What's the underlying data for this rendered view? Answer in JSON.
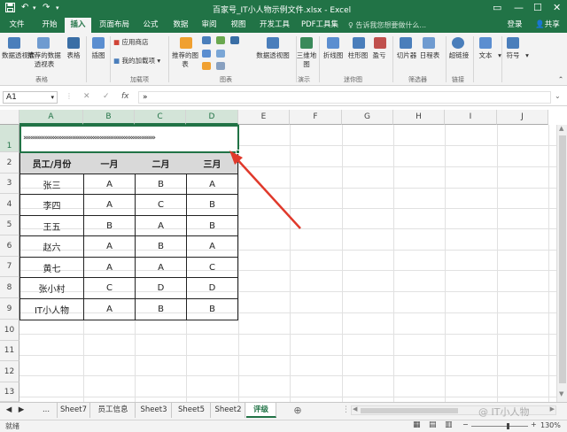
{
  "titlebar": {
    "title": "百家号_IT小人物示例文件.xlsx - Excel",
    "save_icon": "save-icon",
    "undo_icon": "undo-icon",
    "redo_icon": "redo-icon"
  },
  "menu": {
    "tabs": [
      "文件",
      "开始",
      "插入",
      "页面布局",
      "公式",
      "数据",
      "审阅",
      "视图",
      "开发工具",
      "PDF工具集"
    ],
    "active": "插入",
    "tellme": "告诉我您想要做什么...",
    "login": "登录",
    "share": "共享"
  },
  "ribbon": {
    "groups": [
      {
        "label": "表格",
        "buttons": [
          "数据透视表",
          "推荐的数据透视表",
          "表格"
        ]
      },
      {
        "label": "",
        "buttons": [
          "插图"
        ]
      },
      {
        "label": "加载项",
        "buttons": [
          "应用商店",
          "我的加载项"
        ]
      },
      {
        "label": "图表",
        "buttons": [
          "推荐的图表",
          "数据透视图"
        ]
      },
      {
        "label": "演示",
        "buttons": [
          "三维地图"
        ]
      },
      {
        "label": "迷你图",
        "buttons": [
          "折线图",
          "柱形图",
          "盈亏"
        ]
      },
      {
        "label": "筛选器",
        "buttons": [
          "切片器",
          "日程表"
        ]
      },
      {
        "label": "链接",
        "buttons": [
          "超链接"
        ]
      },
      {
        "label": "",
        "buttons": [
          "文本",
          "符号"
        ]
      }
    ]
  },
  "formula": {
    "namebox": "A1",
    "content": "»",
    "cancel": "✕",
    "enter": "✓",
    "fx": "fx"
  },
  "sheet": {
    "columns": [
      "A",
      "B",
      "C",
      "D",
      "E",
      "F",
      "G",
      "H",
      "I",
      "J"
    ],
    "rows": [
      "1",
      "2",
      "3",
      "4",
      "5",
      "6",
      "7",
      "8",
      "9",
      "10",
      "11",
      "12",
      "13"
    ],
    "a1_text": "»»»»»»»»»»»»»»»»»»»»»»»»»»»»»»»»»»»»»»",
    "table": {
      "header": [
        "员工/月份",
        "一月",
        "二月",
        "三月"
      ],
      "body": [
        [
          "张三",
          "A",
          "B",
          "A"
        ],
        [
          "李四",
          "A",
          "C",
          "B"
        ],
        [
          "王五",
          "B",
          "A",
          "B"
        ],
        [
          "赵六",
          "A",
          "B",
          "A"
        ],
        [
          "黄七",
          "A",
          "A",
          "C"
        ],
        [
          "张小村",
          "C",
          "D",
          "D"
        ],
        [
          "IT小人物",
          "A",
          "B",
          "B"
        ]
      ]
    }
  },
  "sheettabs": {
    "nav": [
      "◀",
      "▶",
      "..."
    ],
    "tabs": [
      "Sheet7",
      "员工信息",
      "Sheet3",
      "Sheet5",
      "Sheet2",
      "评级"
    ],
    "active": "评级",
    "add": "⊕"
  },
  "status": {
    "ready": "就绪",
    "zoom": "130%",
    "watermark": "@ IT小人物"
  },
  "colors": {
    "accent": "#217346",
    "arrow": "#e0392b"
  }
}
